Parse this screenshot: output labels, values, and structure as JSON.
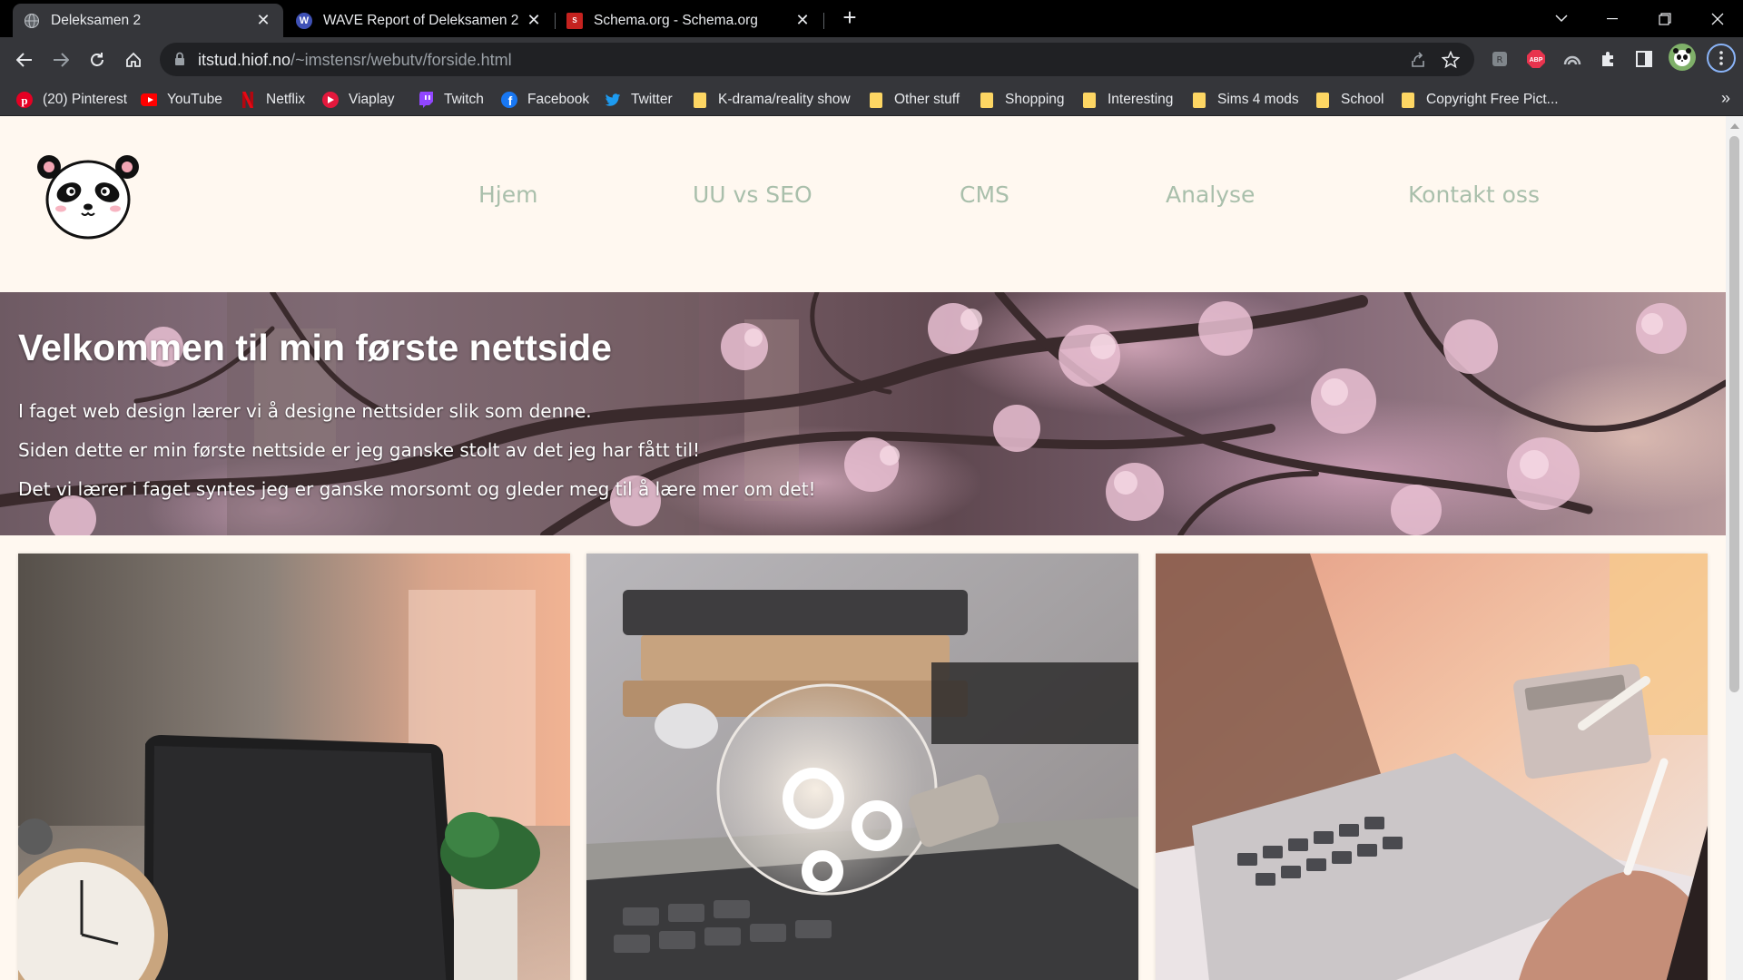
{
  "browser": {
    "tabs": [
      {
        "title": "Deleksamen 2",
        "active": true,
        "favicon": "globe-icon"
      },
      {
        "title": "WAVE Report of Deleksamen 2",
        "active": false,
        "favicon": "wave-icon"
      },
      {
        "title": "Schema.org - Schema.org",
        "active": false,
        "favicon": "schema-icon"
      }
    ],
    "address": {
      "host": "itstud.hiof.no",
      "path": "/~imstensr/webutv/forside.html"
    },
    "bookmarks": [
      {
        "label": "(20) Pinterest",
        "icon": "pinterest-icon"
      },
      {
        "label": "YouTube",
        "icon": "youtube-icon"
      },
      {
        "label": "Netflix",
        "icon": "netflix-icon"
      },
      {
        "label": "Viaplay",
        "icon": "viaplay-icon"
      },
      {
        "label": "Twitch",
        "icon": "twitch-icon"
      },
      {
        "label": "Facebook",
        "icon": "facebook-icon"
      },
      {
        "label": "Twitter",
        "icon": "twitter-icon"
      },
      {
        "label": "K-drama/reality show",
        "icon": "folder-icon"
      },
      {
        "label": "Other stuff",
        "icon": "folder-icon"
      },
      {
        "label": "Shopping",
        "icon": "folder-icon"
      },
      {
        "label": "Interesting",
        "icon": "folder-icon"
      },
      {
        "label": "Sims 4 mods",
        "icon": "folder-icon"
      },
      {
        "label": "School",
        "icon": "folder-icon"
      },
      {
        "label": "Copyright Free Pict...",
        "icon": "folder-icon"
      }
    ],
    "extension_abp": "ABP"
  },
  "site": {
    "nav": [
      "Hjem",
      "UU vs SEO",
      "CMS",
      "Analyse",
      "Kontakt oss"
    ],
    "hero": {
      "title": "Velkommen til min første nettside",
      "paragraphs": [
        "I faget web design lærer vi å designe nettsider slik som denne.",
        "Siden dette er min første nettside er jeg ganske stolt av det jeg har fått til!",
        "Det vi lærer i faget syntes jeg er ganske morsomt og gleder meg til å lære mer om det!"
      ]
    },
    "colors": {
      "page_bg": "#fff8f0",
      "nav_text": "#a9bfab"
    }
  }
}
